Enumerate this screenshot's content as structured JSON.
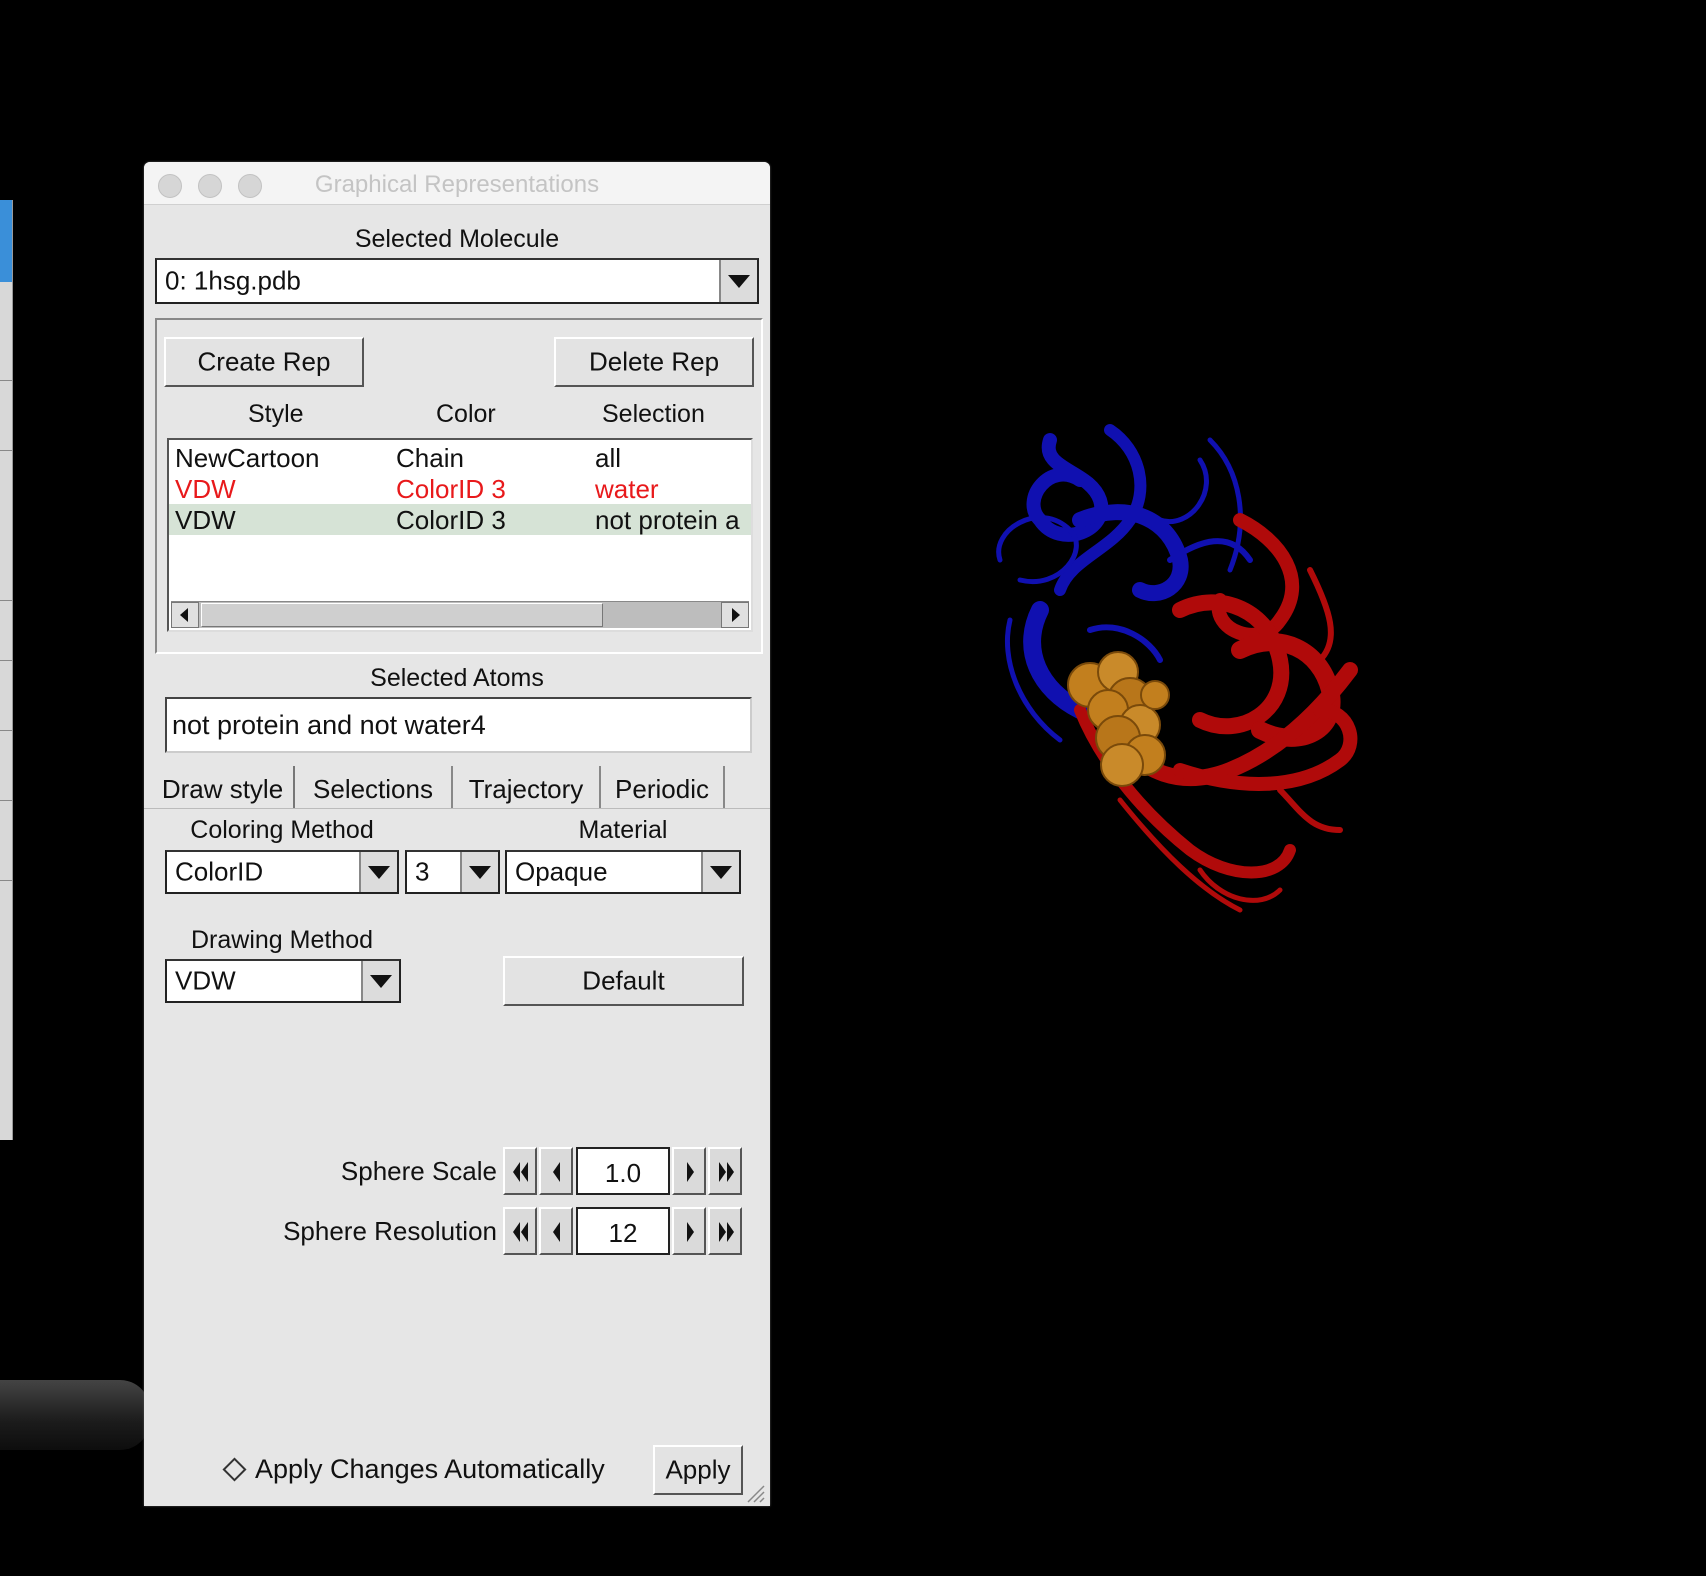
{
  "window": {
    "title": "Graphical Representations"
  },
  "molecule_select": {
    "label": "Selected Molecule",
    "value": "0: 1hsg.pdb"
  },
  "rep_buttons": {
    "create": "Create Rep",
    "delete": "Delete Rep"
  },
  "rep_table": {
    "columns": [
      "Style",
      "Color",
      "Selection"
    ],
    "rows": [
      {
        "style": "NewCartoon",
        "color": "Chain",
        "selection": "all",
        "text_color": "#111111",
        "selected": false
      },
      {
        "style": "VDW",
        "color": "ColorID 3",
        "selection": "water",
        "text_color": "#e8191b",
        "selected": false
      },
      {
        "style": "VDW",
        "color": "ColorID 3",
        "selection": "not protein a",
        "text_color": "#111111",
        "selected": true
      }
    ]
  },
  "selected_atoms": {
    "label": "Selected Atoms",
    "value": "not protein and not water4"
  },
  "tabs": [
    "Draw style",
    "Selections",
    "Trajectory",
    "Periodic"
  ],
  "active_tab": "Draw style",
  "draw_style": {
    "coloring_method_label": "Coloring Method",
    "coloring_method_value": "ColorID",
    "color_id_value": "3",
    "material_label": "Material",
    "material_value": "Opaque",
    "drawing_method_label": "Drawing Method",
    "drawing_method_value": "VDW",
    "default_button": "Default",
    "sphere_scale_label": "Sphere Scale",
    "sphere_scale_value": "1.0",
    "sphere_resolution_label": "Sphere Resolution",
    "sphere_resolution_value": "12"
  },
  "footer": {
    "auto_apply_label": "Apply Changes Automatically",
    "apply_button": "Apply"
  },
  "colors": {
    "selected_row_bg": "#d6e3d6",
    "chain_a": "#1010b0",
    "chain_b": "#b00a0a",
    "ligand": "#c27f1e",
    "background": "#000000"
  }
}
